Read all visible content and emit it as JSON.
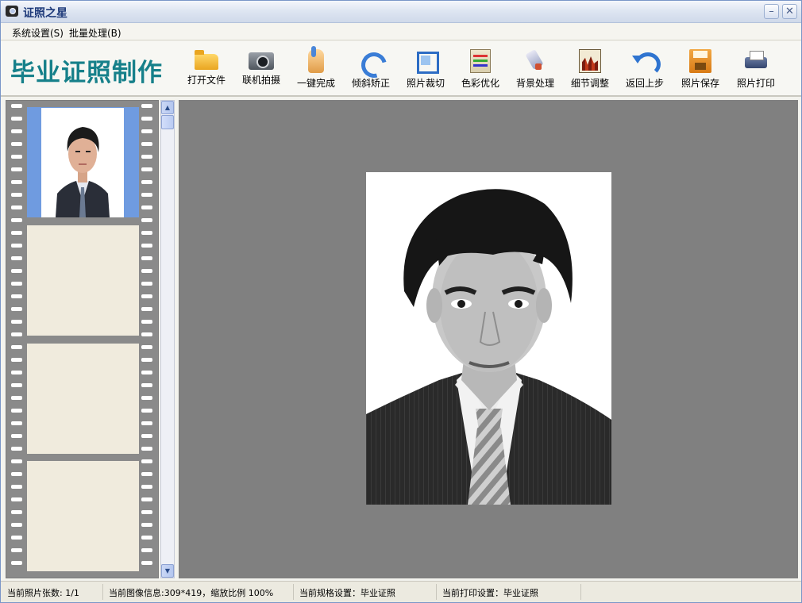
{
  "window": {
    "title": "证照之星"
  },
  "menu": {
    "items": [
      {
        "label": "系统设置(S)"
      },
      {
        "label": "批量处理(B)"
      }
    ]
  },
  "brand": {
    "title": "毕业证照制作"
  },
  "toolbar": {
    "items": [
      {
        "label": "打开文件",
        "icon": "folder-open-icon"
      },
      {
        "label": "联机拍摄",
        "icon": "camera-icon"
      },
      {
        "label": "一键完成",
        "icon": "hand-pointer-icon"
      },
      {
        "label": "倾斜矫正",
        "icon": "rotate-icon"
      },
      {
        "label": "照片裁切",
        "icon": "crop-icon"
      },
      {
        "label": "色彩优化",
        "icon": "color-adjust-icon"
      },
      {
        "label": "背景处理",
        "icon": "brush-icon"
      },
      {
        "label": "细节调整",
        "icon": "histogram-icon"
      },
      {
        "label": "返回上步",
        "icon": "undo-icon"
      },
      {
        "label": "照片保存",
        "icon": "save-icon"
      },
      {
        "label": "照片打印",
        "icon": "printer-icon"
      }
    ]
  },
  "filmstrip": {
    "frames": [
      {
        "state": "selected",
        "has_photo": true
      },
      {
        "state": "empty",
        "has_photo": false
      },
      {
        "state": "empty",
        "has_photo": false
      },
      {
        "state": "empty",
        "has_photo": false
      }
    ]
  },
  "colors": {
    "brand": "#16808a",
    "canvas_bg": "#808080",
    "selected_frame": "#6f9be0",
    "empty_frame": "#f0ebdd"
  },
  "status": {
    "photo_count": "当前照片张数: 1/1",
    "image_info": "当前图像信息:309*419，缩放比例 100%",
    "spec_setting": "当前规格设置：毕业证照",
    "print_setting": "当前打印设置：毕业证照"
  }
}
